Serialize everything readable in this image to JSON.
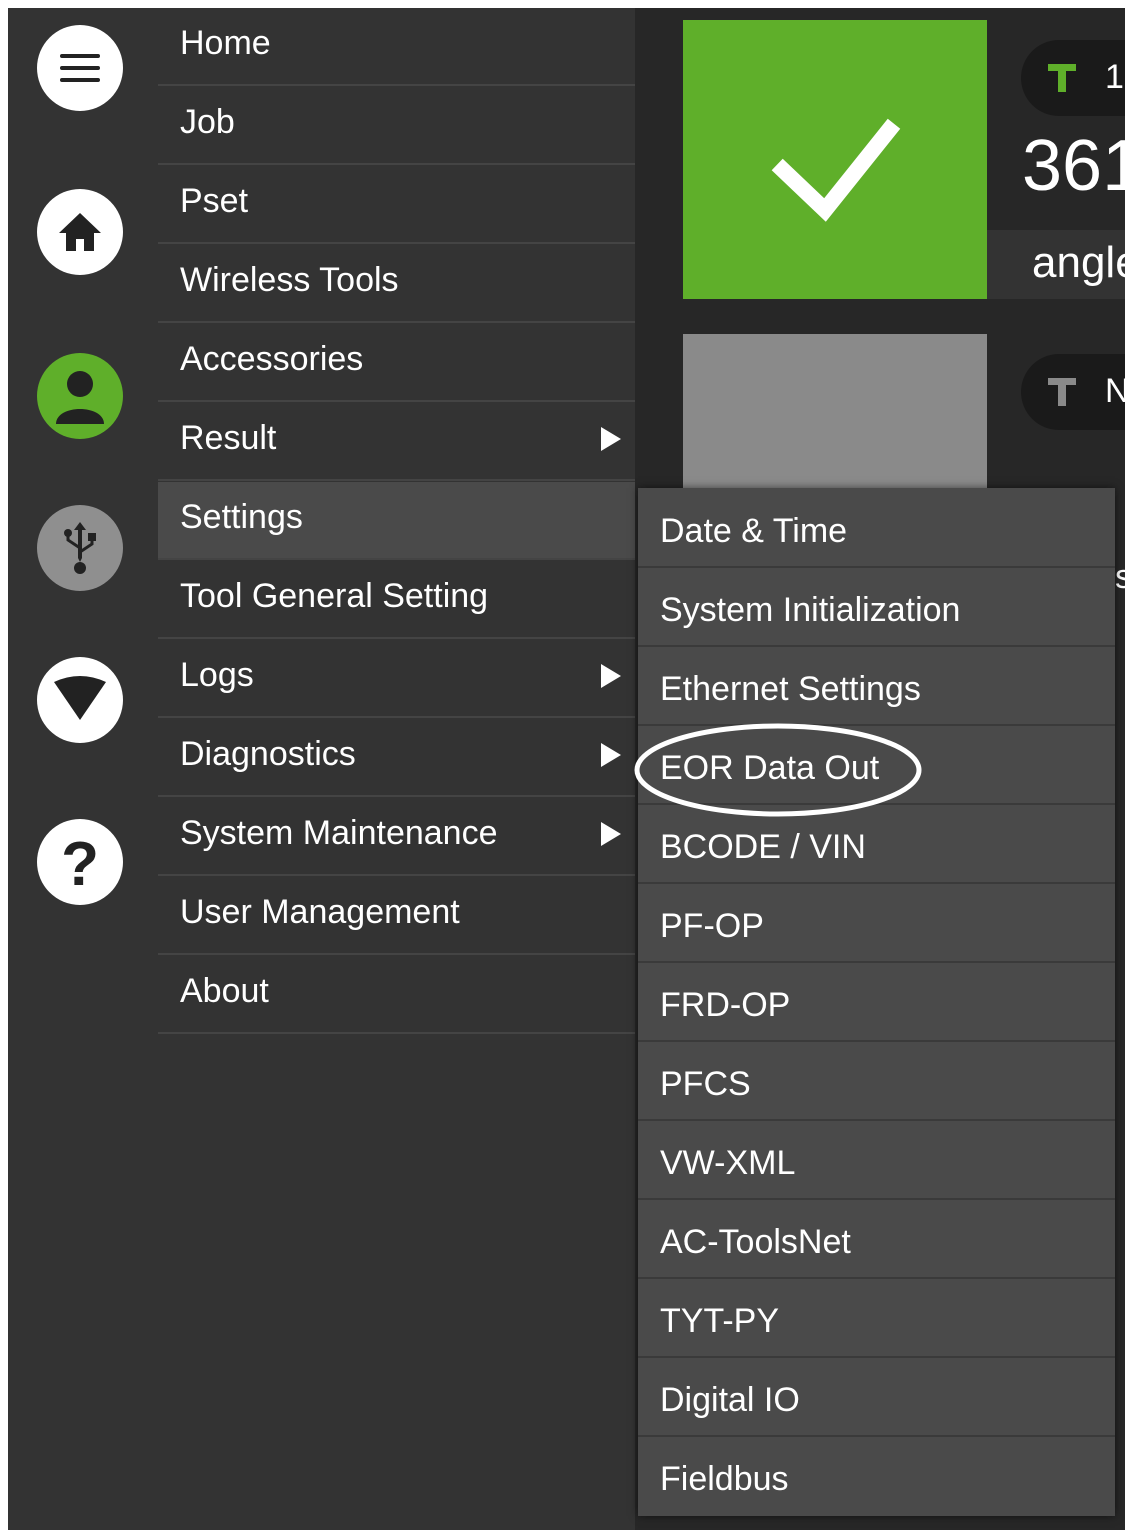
{
  "rail": {
    "icons": [
      "menu-icon",
      "home-icon",
      "user-icon",
      "usb-icon",
      "wifi-icon",
      "help-icon"
    ]
  },
  "main_menu": {
    "items": [
      {
        "label": "Home",
        "has_submenu": false
      },
      {
        "label": "Job",
        "has_submenu": false
      },
      {
        "label": "Pset",
        "has_submenu": false
      },
      {
        "label": "Wireless Tools",
        "has_submenu": false
      },
      {
        "label": "Accessories",
        "has_submenu": false
      },
      {
        "label": "Result",
        "has_submenu": true
      },
      {
        "label": "Settings",
        "has_submenu": false,
        "active": true
      },
      {
        "label": "Tool General Setting",
        "has_submenu": false
      },
      {
        "label": "Logs",
        "has_submenu": true
      },
      {
        "label": "Diagnostics",
        "has_submenu": true
      },
      {
        "label": "System Maintenance",
        "has_submenu": true
      },
      {
        "label": "User Management",
        "has_submenu": false
      },
      {
        "label": "About",
        "has_submenu": false
      }
    ]
  },
  "settings_submenu": {
    "items": [
      "Date & Time",
      "System Initialization",
      "Ethernet Settings",
      "EOR Data Out",
      "BCODE / VIN",
      "PF-OP",
      "FRD-OP",
      "PFCS",
      "VW-XML",
      "AC-ToolsNet",
      "TYT-PY",
      "Digital IO",
      "Fieldbus"
    ],
    "highlighted": "EOR Data Out"
  },
  "background": {
    "tool1_label": "1",
    "tool2_label": "N",
    "result_value": "361",
    "result_unit": "angle",
    "stub_text": "s"
  },
  "colors": {
    "ok_green": "#5faf2a",
    "user_green": "#5faf2a",
    "menu_bg": "#333333",
    "submenu_bg": "#4a4a4a",
    "pending_grey": "#8a8a8a"
  }
}
